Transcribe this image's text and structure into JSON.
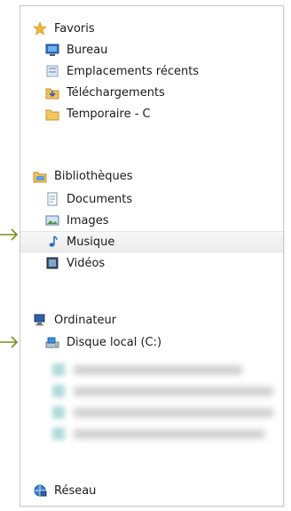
{
  "favorites": {
    "title": "Favoris",
    "items": [
      {
        "label": "Bureau",
        "icon": "desktop-icon"
      },
      {
        "label": "Emplacements récents",
        "icon": "recent-places-icon"
      },
      {
        "label": "Téléchargements",
        "icon": "downloads-icon"
      },
      {
        "label": "Temporaire - C",
        "icon": "folder-icon"
      }
    ]
  },
  "libraries": {
    "title": "Bibliothèques",
    "items": [
      {
        "label": "Documents",
        "icon": "document-icon"
      },
      {
        "label": "Images",
        "icon": "image-icon"
      },
      {
        "label": "Musique",
        "icon": "music-note-icon"
      },
      {
        "label": "Vidéos",
        "icon": "video-icon"
      }
    ]
  },
  "computer": {
    "title": "Ordinateur",
    "items": [
      {
        "label": "Disque local (C:)",
        "icon": "hard-drive-icon"
      }
    ]
  },
  "network": {
    "title": "Réseau"
  },
  "colors": {
    "arrow": "#7b8c1e",
    "highlight": "#ececec",
    "border": "#c9c9c9"
  }
}
